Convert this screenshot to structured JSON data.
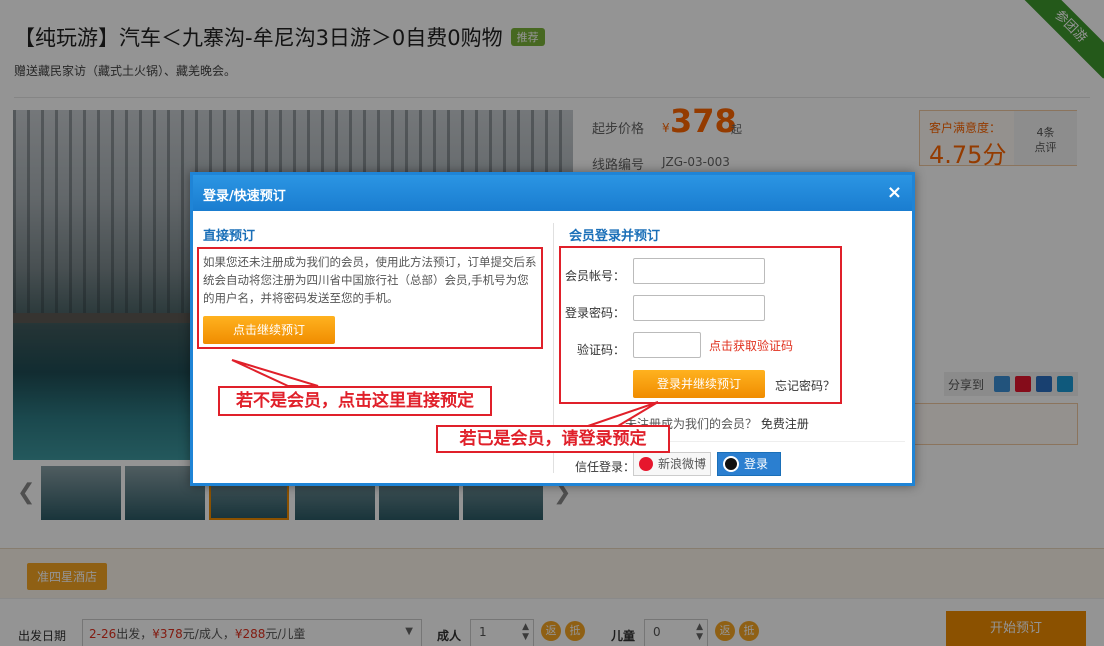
{
  "product": {
    "title": "【纯玩游】汽车＜九寨沟-牟尼沟3日游＞0自费0购物",
    "badge": "推荐",
    "subtitle": "赠送藏民家访（藏式土火锅）、藏羌晚会。",
    "ribbon": "参团游",
    "price_label": "起步价格",
    "price_currency": "¥",
    "price_value": "378",
    "price_suffix": "起",
    "route_label": "线路编号",
    "route_code": "JZG-03-003"
  },
  "satisfaction": {
    "label": "客户满意度：",
    "score": "4.75分",
    "count": "4条",
    "reviews": "点评"
  },
  "share": {
    "label": "分享到"
  },
  "hotel": {
    "label": "准四星酒店"
  },
  "booking": {
    "departure_label": "出发日期",
    "departure_date": "2-26",
    "departure_text1": "出发，",
    "adult_price": "¥378",
    "adult_text": "元/成人，",
    "child_price": "¥288",
    "child_text": "元/儿童",
    "adults_label": "成人",
    "adults_value": "1",
    "children_label": "儿童",
    "children_value": "0",
    "circle_a": "返",
    "circle_b": "抵",
    "start_button": "开始预订"
  },
  "modal": {
    "title": "登录/快速预订",
    "close": "×",
    "direct": {
      "heading": "直接预订",
      "description": "如果您还未注册成为我们的会员，使用此方法预订，订单提交后系统会自动将您注册为四川省中国旅行社（总部）会员,手机号为您的用户名，并将密码发送至您的手机。",
      "continue_button": "点击继续预订"
    },
    "member": {
      "heading": "会员登录并预订",
      "account_label": "会员帐号：",
      "password_label": "登录密码：",
      "captcha_label": "验证码：",
      "get_captcha": "点击获取验证码",
      "login_button": "登录并继续预订",
      "forgot": "忘记密码？",
      "not_registered": "未注册成为我们的会员？",
      "register": "免费注册",
      "trust_label": "信任登录：",
      "weibo": "新浪微博",
      "qq": "登录"
    }
  },
  "annotations": {
    "not_member": "若不是会员，点击这里直接预定",
    "is_member": "若已是会员，请登录预定"
  }
}
